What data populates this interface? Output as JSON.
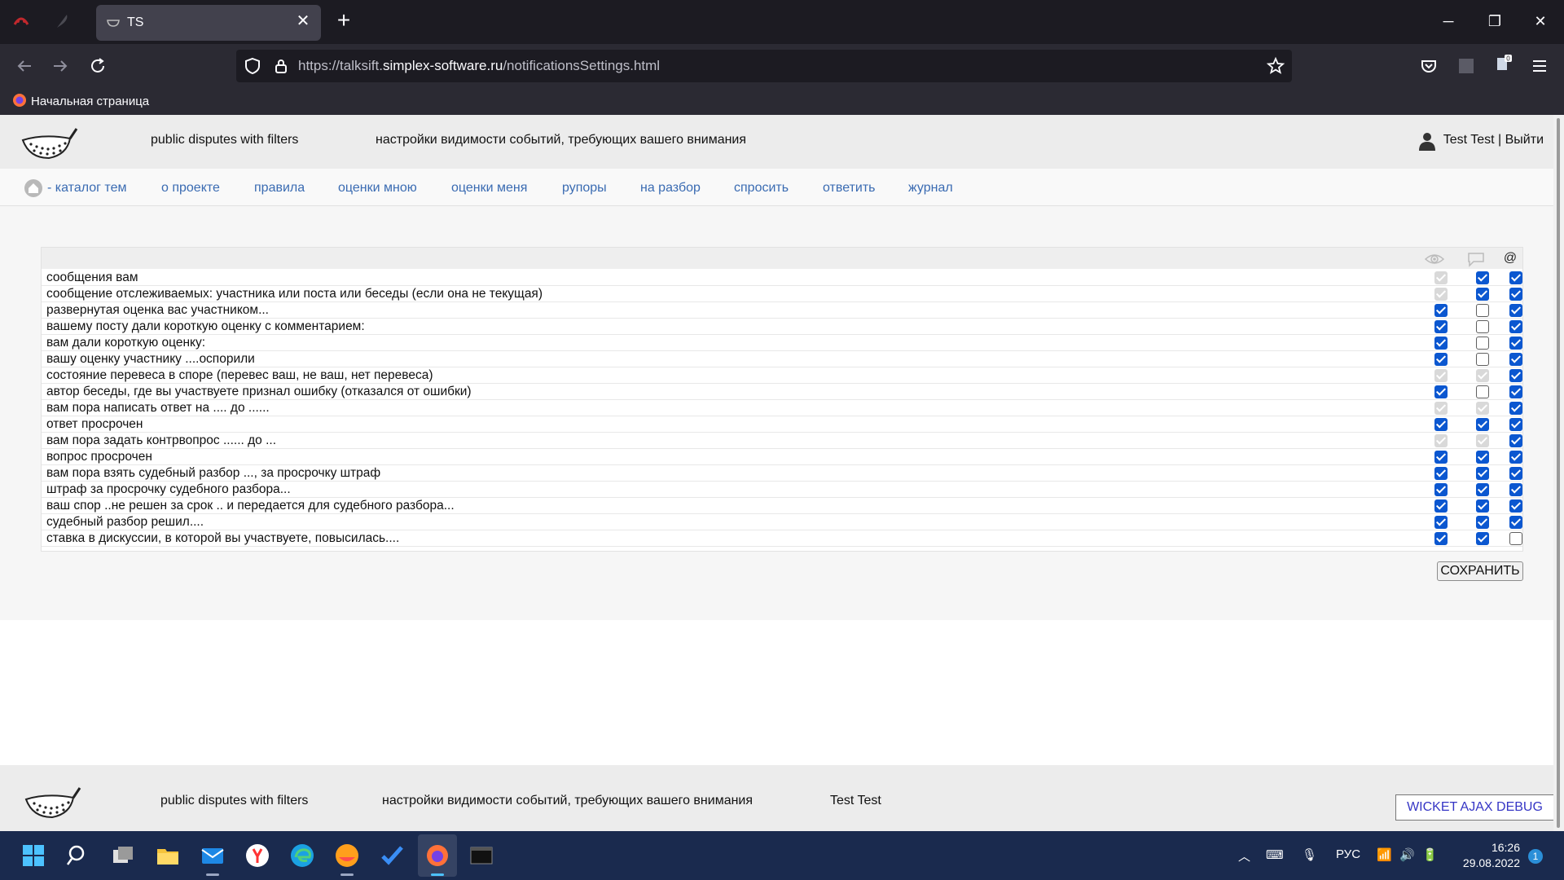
{
  "browser": {
    "tab_title": "TS",
    "url_prefix": "https://talksift.",
    "url_domain": "simplex-software.ru",
    "url_suffix": "/notificationsSettings.html",
    "bookmark_label": "Начальная страница"
  },
  "header": {
    "site_name": "public disputes with filters",
    "page_title": "настройки видимости событий, требующих вашего внимания",
    "user": "Test Test | Выйти"
  },
  "menu": {
    "home": "- каталог тем",
    "items": [
      "о проекте",
      "правила",
      "оценки мною",
      "оценки меня",
      "рупоры",
      "на разбор",
      "спросить",
      "ответить",
      "журнал"
    ]
  },
  "settings": {
    "columns": [
      "eye-icon",
      "comment-icon",
      "@"
    ],
    "rows": [
      {
        "label": "сообщения вам",
        "states": [
          "disabled",
          "on",
          "on"
        ]
      },
      {
        "label": "сообщение отслеживаемых: участника или поста или беседы (если она не текущая)",
        "states": [
          "disabled",
          "on",
          "on"
        ]
      },
      {
        "label": "развернутая оценка вас участником...",
        "states": [
          "on",
          "off",
          "on"
        ]
      },
      {
        "label": "вашему посту дали короткую оценку с комментарием:",
        "states": [
          "on",
          "off",
          "on"
        ]
      },
      {
        "label": "вам дали короткую оценку:",
        "states": [
          "on",
          "off",
          "on"
        ]
      },
      {
        "label": "вашу оценку участнику ....оспорили",
        "states": [
          "on",
          "off",
          "on"
        ]
      },
      {
        "label": "состояние перевеса в споре (перевес ваш, не ваш, нет перевеса)",
        "states": [
          "disabled",
          "disabled",
          "on"
        ]
      },
      {
        "label": "автор беседы, где вы участвуете признал ошибку (отказался от ошибки)",
        "states": [
          "on",
          "off",
          "on"
        ]
      },
      {
        "label": "вам пора написать ответ на .... до ......",
        "states": [
          "disabled",
          "disabled",
          "on"
        ]
      },
      {
        "label": "ответ просрочен",
        "states": [
          "on",
          "on",
          "on"
        ]
      },
      {
        "label": "вам пора задать контрвопрос ...... до ...",
        "states": [
          "disabled",
          "disabled",
          "on"
        ]
      },
      {
        "label": "вопрос просрочен",
        "states": [
          "on",
          "on",
          "on"
        ]
      },
      {
        "label": "вам пора взять судебный разбор ..., за просрочку штраф",
        "states": [
          "on",
          "on",
          "on"
        ]
      },
      {
        "label": "штраф за просрочку судебного разбора...",
        "states": [
          "on",
          "on",
          "on"
        ]
      },
      {
        "label": "ваш спор ..не решен за срок .. и передается для судебного разбора...",
        "states": [
          "on",
          "on",
          "on"
        ]
      },
      {
        "label": "судебный разбор решил....",
        "states": [
          "on",
          "on",
          "on"
        ]
      },
      {
        "label": "ставка в дискуссии, в которой вы участвуете, повысилась....",
        "states": [
          "on",
          "on",
          "off"
        ]
      }
    ],
    "save_label": "СОХРАНИТЬ"
  },
  "footer": {
    "site_name": "public disputes with filters",
    "page_title": "настройки видимости событий, требующих вашего внимания",
    "user": "Test Test",
    "debug_label": "WICKET AJAX DEBUG"
  },
  "taskbar": {
    "lang": "РУС",
    "time": "16:26",
    "date": "29.08.2022",
    "notifications": "1"
  },
  "colors": {
    "accent": "#0b57d0",
    "link": "#3a6bb2",
    "taskbar": "#1a2a4e"
  }
}
